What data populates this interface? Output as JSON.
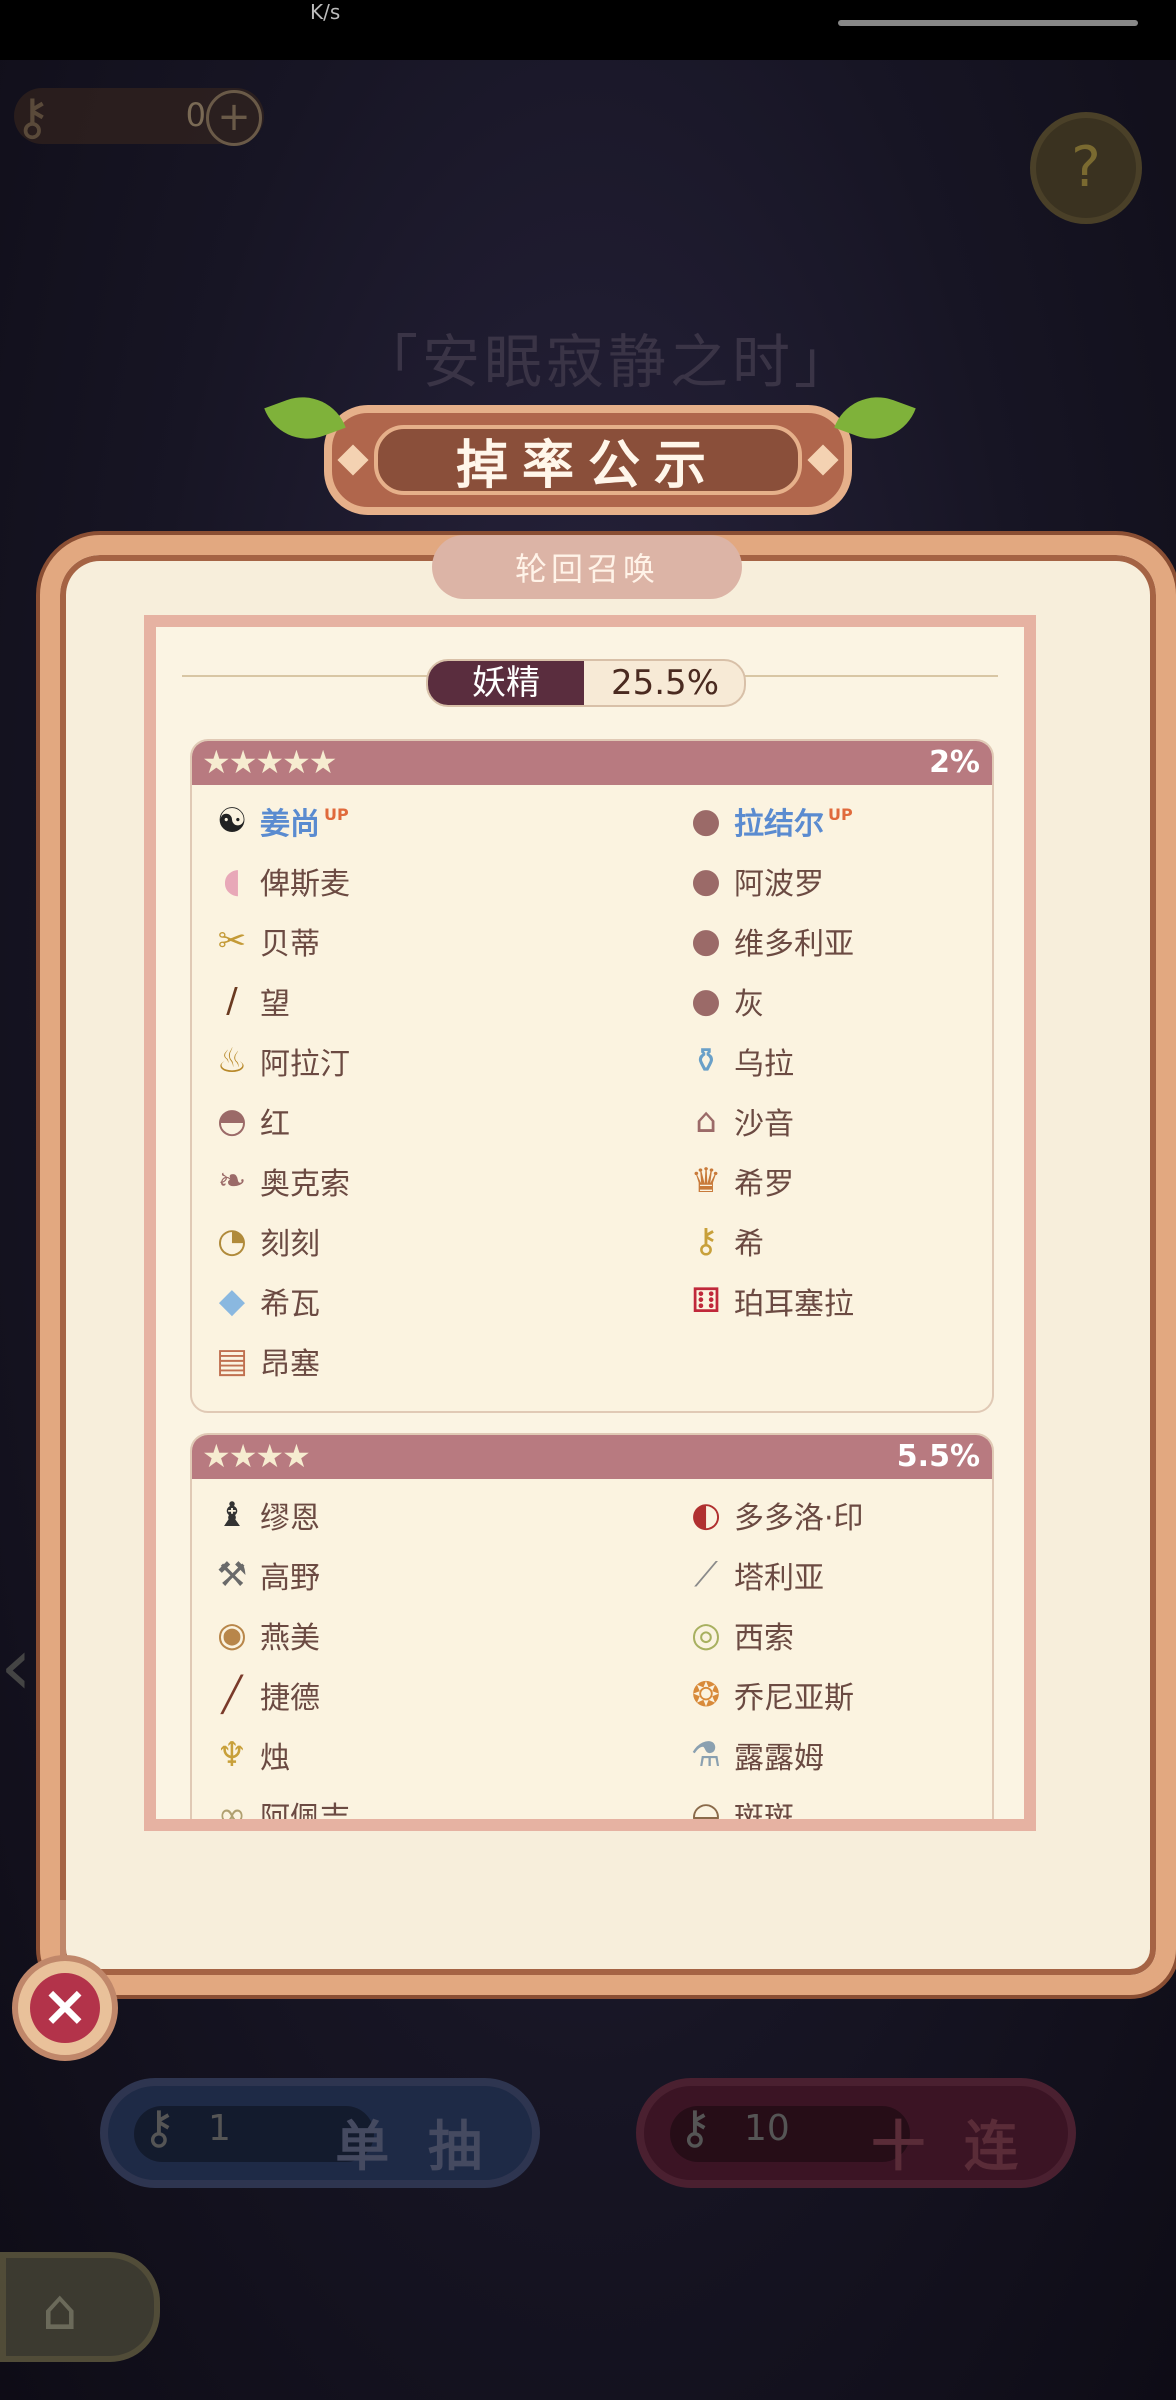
{
  "status": {
    "speed": "K/s"
  },
  "keys": {
    "count": "0",
    "plus": "+"
  },
  "help": {
    "icon": "?"
  },
  "event_title": "「安眠寂静之时」",
  "dialog": {
    "title": "掉率公示",
    "subtitle": "轮回召唤",
    "category": {
      "label": "妖精",
      "rate": "25.5%"
    },
    "sections": [
      {
        "stars": "★★★★★",
        "rate": "2%",
        "left": [
          {
            "name": "姜尚",
            "up": "UP",
            "icon": "yin-yang-icon"
          },
          {
            "name": "俾斯麦",
            "icon": "pill-icon"
          },
          {
            "name": "贝蒂",
            "icon": "scissors-icon"
          },
          {
            "name": "望",
            "icon": "staff-icon"
          },
          {
            "name": "阿拉汀",
            "icon": "lamp-icon"
          },
          {
            "name": "红",
            "icon": "basket-icon"
          },
          {
            "name": "奥克索",
            "icon": "feather-icon"
          },
          {
            "name": "刻刻",
            "icon": "pocket-watch-icon"
          },
          {
            "name": "希瓦",
            "icon": "crystal-icon"
          },
          {
            "name": "昂塞",
            "icon": "book-icon"
          }
        ],
        "right": [
          {
            "name": "拉结尔",
            "up": "UP",
            "icon": "silhouette-icon"
          },
          {
            "name": "阿波罗",
            "icon": "silhouette-icon"
          },
          {
            "name": "维多利亚",
            "icon": "silhouette-icon"
          },
          {
            "name": "灰",
            "icon": "silhouette-icon"
          },
          {
            "name": "乌拉",
            "icon": "bottle-icon"
          },
          {
            "name": "沙音",
            "icon": "birdcage-icon"
          },
          {
            "name": "希罗",
            "icon": "crown-icon"
          },
          {
            "name": "希",
            "icon": "key-icon"
          },
          {
            "name": "珀耳塞拉",
            "icon": "dice-icon"
          }
        ]
      },
      {
        "stars": "★★★★",
        "rate": "5.5%",
        "left": [
          {
            "name": "缪恩",
            "icon": "chess-icon"
          },
          {
            "name": "高野",
            "icon": "hammer-icon"
          },
          {
            "name": "燕美",
            "icon": "steamer-icon"
          },
          {
            "name": "捷德",
            "icon": "needle-icon"
          },
          {
            "name": "烛",
            "icon": "candle-icon"
          },
          {
            "name": "阿佩吉",
            "icon": "glasses-icon"
          }
        ],
        "right": [
          {
            "name": "多多洛·印",
            "icon": "seal-icon"
          },
          {
            "name": "塔利亚",
            "icon": "knife-icon"
          },
          {
            "name": "西索",
            "icon": "tape-icon"
          },
          {
            "name": "乔尼亚斯",
            "icon": "balls-icon"
          },
          {
            "name": "露露姆",
            "icon": "test-tube-icon"
          },
          {
            "name": "斑斑",
            "icon": "bag-icon"
          }
        ]
      }
    ]
  },
  "buttons": {
    "single": {
      "count": "1",
      "label": "单 抽"
    },
    "ten": {
      "count": "10",
      "label": "十 连"
    }
  },
  "colors": {
    "accent": "#b87a80",
    "up_name": "#5a8bd0",
    "up_badge": "#e06a3c",
    "close": "#b3334a"
  }
}
